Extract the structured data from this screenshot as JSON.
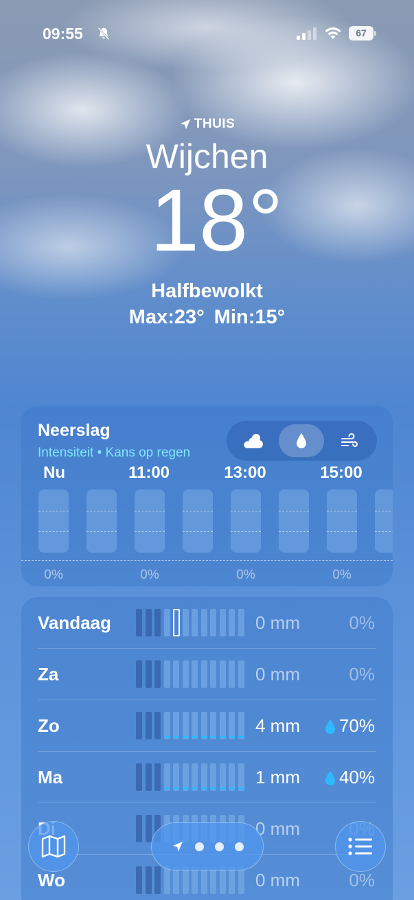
{
  "status_bar": {
    "time": "09:55",
    "battery": "67",
    "icons": [
      "bell-slash-icon",
      "cellular-signal-icon",
      "wifi-icon",
      "battery-icon"
    ]
  },
  "header": {
    "location_label": "THUIS",
    "city": "Wijchen",
    "temperature": "18°",
    "condition": "Halfbewolkt",
    "hi_lo": "Max:23°  Min:15°"
  },
  "precip_card": {
    "title": "Neerslag",
    "subtitle": "Intensiteit • Kans op regen",
    "modes": [
      {
        "icon": "cloud-sun-icon",
        "active": false
      },
      {
        "icon": "raindrop-icon",
        "active": true
      },
      {
        "icon": "wind-icon",
        "active": false
      }
    ],
    "hour_labels": [
      "Nu",
      "11:00",
      "13:00",
      "15:00"
    ],
    "percents": [
      "0%",
      "0%",
      "0%",
      "0%"
    ]
  },
  "daily": [
    {
      "day": "Vandaag",
      "amount": "0 mm",
      "chance": "0%",
      "rain": false
    },
    {
      "day": "Za",
      "amount": "0 mm",
      "chance": "0%",
      "rain": false
    },
    {
      "day": "Zo",
      "amount": "4 mm",
      "chance": "70%",
      "rain": true
    },
    {
      "day": "Ma",
      "amount": "1 mm",
      "chance": "40%",
      "rain": true
    },
    {
      "day": "Di",
      "amount": "0 mm",
      "chance": "0%",
      "rain": false
    },
    {
      "day": "Wo",
      "amount": "0 mm",
      "chance": "0%",
      "rain": false
    }
  ],
  "toolbar": {
    "map_icon": "map-icon",
    "location_icon": "location-arrow-icon",
    "list_icon": "list-icon"
  },
  "colors": {
    "accent": "#7fe6ff",
    "rain_fill": "#2fb9ff"
  }
}
